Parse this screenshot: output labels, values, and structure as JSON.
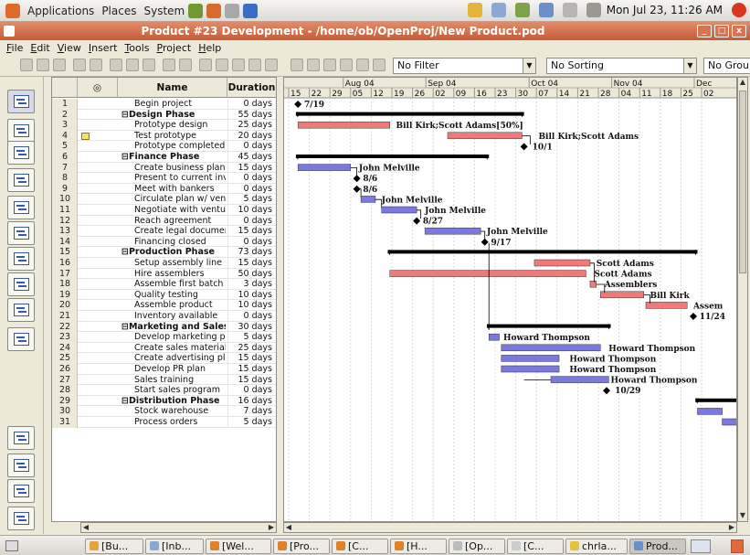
{
  "top_panel": {
    "menus": [
      "Applications",
      "Places",
      "System"
    ],
    "clock": "Mon Jul 23, 11:26 AM"
  },
  "window": {
    "title": "Product #23 Development - /home/ob/OpenProj/New Product.pod"
  },
  "menu": [
    "File",
    "Edit",
    "View",
    "Insert",
    "Tools",
    "Project",
    "Help"
  ],
  "toolbar": {
    "filter": "No Filter",
    "sort": "No Sorting",
    "group": "No Grou"
  },
  "table": {
    "headers": {
      "name": "Name",
      "duration": "Duration"
    },
    "rows": [
      {
        "id": "1",
        "name": "Begin project",
        "dur": "0 days",
        "summary": false,
        "lvl": 1
      },
      {
        "id": "2",
        "name": "⊟Design Phase",
        "dur": "55 days",
        "summary": true,
        "lvl": 0
      },
      {
        "id": "3",
        "name": "Prototype design",
        "dur": "25 days",
        "summary": false,
        "lvl": 1
      },
      {
        "id": "4",
        "name": "Test prototype",
        "dur": "20 days",
        "summary": false,
        "lvl": 1,
        "note": true
      },
      {
        "id": "5",
        "name": "Prototype completed",
        "dur": "0 days",
        "summary": false,
        "lvl": 1
      },
      {
        "id": "6",
        "name": "⊟Finance Phase",
        "dur": "45 days",
        "summary": true,
        "lvl": 0
      },
      {
        "id": "7",
        "name": "Create business plan",
        "dur": "15 days",
        "summary": false,
        "lvl": 1
      },
      {
        "id": "8",
        "name": "Present to current inve",
        "dur": "0 days",
        "summary": false,
        "lvl": 1
      },
      {
        "id": "9",
        "name": "Meet with bankers",
        "dur": "0 days",
        "summary": false,
        "lvl": 1
      },
      {
        "id": "10",
        "name": "Circulate plan w/ vent",
        "dur": "5 days",
        "summary": false,
        "lvl": 1
      },
      {
        "id": "11",
        "name": "Negotiate with venture",
        "dur": "10 days",
        "summary": false,
        "lvl": 1
      },
      {
        "id": "12",
        "name": "Reach agreement",
        "dur": "0 days",
        "summary": false,
        "lvl": 1
      },
      {
        "id": "13",
        "name": "Create legal document",
        "dur": "15 days",
        "summary": false,
        "lvl": 1
      },
      {
        "id": "14",
        "name": "Financing closed",
        "dur": "0 days",
        "summary": false,
        "lvl": 1
      },
      {
        "id": "15",
        "name": "⊟Production Phase",
        "dur": "73 days",
        "summary": true,
        "lvl": 0
      },
      {
        "id": "16",
        "name": "Setup assembly line",
        "dur": "15 days",
        "summary": false,
        "lvl": 1
      },
      {
        "id": "17",
        "name": "Hire assemblers",
        "dur": "50 days",
        "summary": false,
        "lvl": 1
      },
      {
        "id": "18",
        "name": "Assemble first batch",
        "dur": "3 days",
        "summary": false,
        "lvl": 1
      },
      {
        "id": "19",
        "name": "Quality testing",
        "dur": "10 days",
        "summary": false,
        "lvl": 1
      },
      {
        "id": "20",
        "name": "Assemble product",
        "dur": "10 days",
        "summary": false,
        "lvl": 1
      },
      {
        "id": "21",
        "name": "Inventory available",
        "dur": "0 days",
        "summary": false,
        "lvl": 1
      },
      {
        "id": "22",
        "name": "⊟Marketing and Sales P",
        "dur": "30 days",
        "summary": true,
        "lvl": 0
      },
      {
        "id": "23",
        "name": "Develop marketing pla",
        "dur": "5 days",
        "summary": false,
        "lvl": 1
      },
      {
        "id": "24",
        "name": "Create sales materials",
        "dur": "25 days",
        "summary": false,
        "lvl": 1
      },
      {
        "id": "25",
        "name": "Create advertising pla",
        "dur": "15 days",
        "summary": false,
        "lvl": 1
      },
      {
        "id": "26",
        "name": "Develop PR plan",
        "dur": "15 days",
        "summary": false,
        "lvl": 1
      },
      {
        "id": "27",
        "name": "Sales training",
        "dur": "15 days",
        "summary": false,
        "lvl": 1
      },
      {
        "id": "28",
        "name": "Start sales program",
        "dur": "0 days",
        "summary": false,
        "lvl": 1
      },
      {
        "id": "29",
        "name": "⊟Distribution Phase",
        "dur": "16 days",
        "summary": true,
        "lvl": 0
      },
      {
        "id": "30",
        "name": "Stock warehouse",
        "dur": "7 days",
        "summary": false,
        "lvl": 1
      },
      {
        "id": "31",
        "name": "Process orders",
        "dur": "5 days",
        "summary": false,
        "lvl": 1
      }
    ]
  },
  "gantt": {
    "months": [
      {
        "label": "Aug 04",
        "col": 3
      },
      {
        "label": "Sep 04",
        "col": 7
      },
      {
        "label": "Oct 04",
        "col": 12
      },
      {
        "label": "Nov 04",
        "col": 16
      },
      {
        "label": "Dec",
        "col": 20
      }
    ],
    "days": [
      "15",
      "22",
      "29",
      "05",
      "12",
      "19",
      "26",
      "02",
      "09",
      "16",
      "23",
      "30",
      "07",
      "14",
      "21",
      "28",
      "04",
      "11",
      "18",
      "25",
      "02"
    ],
    "labels": {
      "r1": "7/19",
      "r3": "Bill Kirk;Scott Adams[50%]",
      "r4": "Bill Kirk;Scott Adams",
      "r5": "10/1",
      "r7": "John Melville",
      "r8": "8/6",
      "r9": "8/6",
      "r10": "John Melville",
      "r11": "John Melville",
      "r12": "8/27",
      "r13": "John Melville",
      "r14": "9/17",
      "r16": "Scott Adams",
      "r17": "Scott Adams",
      "r18": "Assemblers",
      "r19": "Bill Kirk",
      "r20": "Assem",
      "r21": "11/24",
      "r23": "Howard Thompson",
      "r24": "Howard Thompson",
      "r25": "Howard Thompson",
      "r26": "Howard Thompson",
      "r27": "Howard Thompson",
      "r28": "10/29"
    }
  },
  "taskbar": [
    "[Bu...",
    "[Inb...",
    "[Wel...",
    "[Pro...",
    "[C...",
    "[H...",
    "[Op...",
    "[C...",
    "chrla...",
    "Prod..."
  ],
  "colors": {
    "task_bar": "#7b78e0",
    "critical_bar": "#ee7a7a",
    "summary": "#000000",
    "title_bar": "#c75a36"
  }
}
